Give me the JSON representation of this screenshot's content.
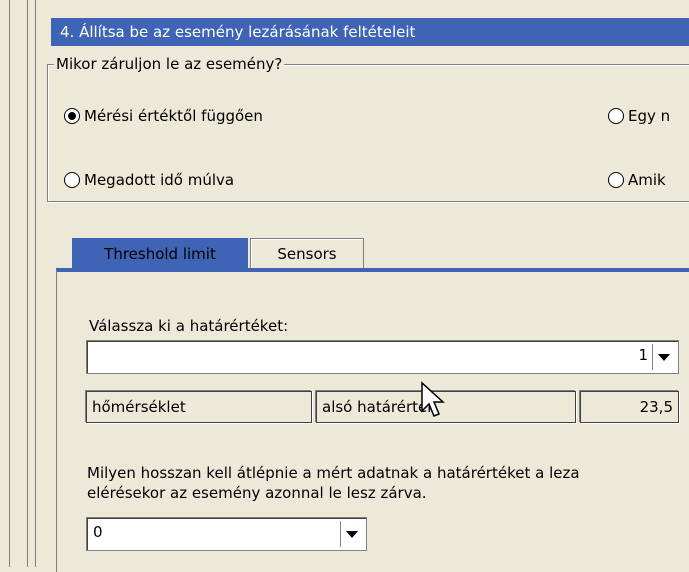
{
  "step_title": "4. Állítsa be az esemény lezárásának feltételeit",
  "group_label": "Mikor záruljon le az esemény?",
  "radios": [
    {
      "label": "Mérési értéktől függően",
      "checked": true
    },
    {
      "label": "Egy n",
      "checked": false
    },
    {
      "label": "Megadott idő múlva",
      "checked": false
    },
    {
      "label": "Amik",
      "checked": false
    }
  ],
  "tabs": [
    {
      "label": "Threshold limit",
      "active": true
    },
    {
      "label": "Sensors",
      "active": false
    }
  ],
  "threshold_select_label": "Válassza ki a határértéket:",
  "threshold_select_value": "1",
  "threshold_row": {
    "sensor": "hőmérséklet",
    "limit_type": "alsó határérték",
    "value": "23,5"
  },
  "duration_text_line1": "Milyen hosszan kell átlépnie a mért adatnak a határértéket a leza",
  "duration_text_line2": "elérésekor az esemény azonnal le lesz zárva.",
  "duration_value": "0",
  "colors": {
    "accent": "#3f64b5",
    "window_bg": "#ece9d8"
  }
}
